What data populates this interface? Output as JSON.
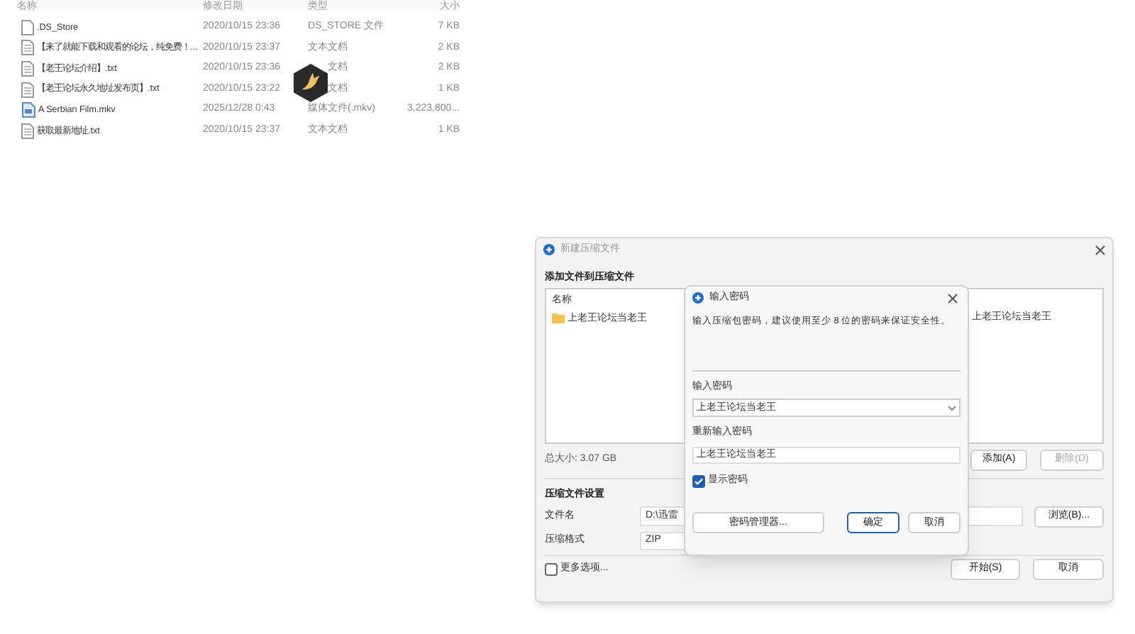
{
  "file_list": {
    "columns": [
      "名称",
      "修改日期",
      "类型",
      "大小"
    ],
    "rows": [
      {
        "kind": "file",
        "name": ".DS_Store",
        "date": "2020/10/15 23:36",
        "type": "DS_STORE 文件",
        "size": "7 KB"
      },
      {
        "kind": "text",
        "name": "【来了就能下载和观看的论坛，纯免费！...",
        "date": "2020/10/15 23:37",
        "type": "文本文档",
        "size": "2 KB"
      },
      {
        "kind": "text",
        "name": "【老王论坛介绍】.txt",
        "date": "2020/10/15 23:36",
        "type": "文档",
        "size": "2 KB"
      },
      {
        "kind": "text",
        "name": "【老王论坛永久地址发布页】.txt",
        "date": "2020/10/15 23:22",
        "type": "文档",
        "size": "1 KB"
      },
      {
        "kind": "video",
        "name": "A Serbian Film.mkv",
        "date": "2025/12/28 0:43",
        "type": "媒体文件(.mkv)",
        "size": "3,223,800..."
      },
      {
        "kind": "text",
        "name": "获取最新地址.txt",
        "date": "2020/10/15 23:37",
        "type": "文本文档",
        "size": "1 KB"
      }
    ]
  },
  "archive_dialog": {
    "title": "新建压缩文件",
    "section_add": "添加文件到压缩文件",
    "list": {
      "column": "名称",
      "items": [
        {
          "name": "上老王论坛当老王"
        }
      ],
      "right_text": "上老王论坛当老王"
    },
    "total_size": "总大小: 3.07 GB",
    "add_button": "添加(A)",
    "remove_button": {
      "label": "删除(D)",
      "disabled": true
    },
    "section_settings": "压缩文件设置",
    "filename_label": "文件名",
    "filename_value": "D:\\迅雷",
    "browse_button": "浏览(B)...",
    "format_label": "压缩格式",
    "format_value": "ZIP",
    "more_options": {
      "label": "更多选项...",
      "checked": false
    },
    "start_button": "开始(S)",
    "cancel_button": "取消"
  },
  "password_dialog": {
    "title": "输入密码",
    "hint": "输入压缩包密码，建议使用至少 8 位的密码来保证安全性。",
    "password_label": "输入密码",
    "password_value": "上老王论坛当老王",
    "repeat_label": "重新输入密码",
    "repeat_value": "上老王论坛当老王",
    "show_password": {
      "label": "显示密码",
      "checked": true
    },
    "manager_button": "密码管理器...",
    "ok_button": "确定",
    "cancel_button": "取消"
  }
}
